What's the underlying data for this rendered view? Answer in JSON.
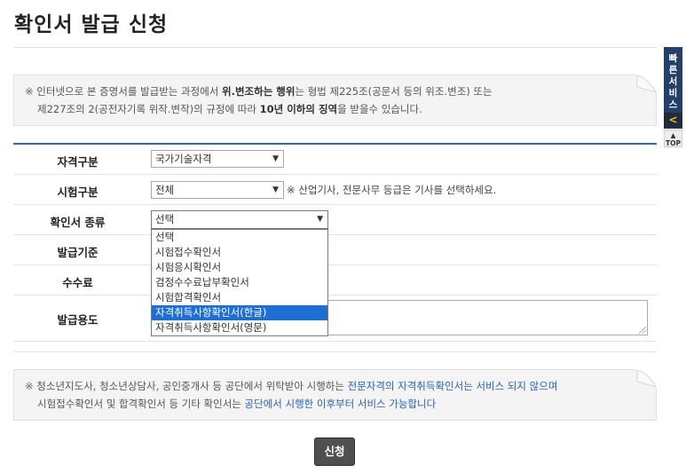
{
  "page_title": "확인서 발급 신청",
  "notice_top": {
    "mark": "※",
    "line1_a": "인터넷으로 본 증명서를 발급받는 과정에서 ",
    "line1_b": "위.변조하는 행위",
    "line1_c": "는 형법 제225조(공문서 등의 위조.변조) 또는",
    "line2_a": "제227조의 2(공전자기록 위작.변작)의 규정에 따라 ",
    "line2_b": "10년 이하의 징역",
    "line2_c": "을 받을수 있습니다."
  },
  "form": {
    "qual_type": {
      "label": "자격구분",
      "value": "국가기술자격"
    },
    "exam_type": {
      "label": "시험구분",
      "value": "전체",
      "hint": "※ 산업기사, 전문사무 등급은 기사를 선택하세요."
    },
    "cert_type": {
      "label": "확인서 종류",
      "value": "선택",
      "options": [
        "선택",
        "시험접수확인서",
        "시험응시확인서",
        "검정수수료납부확인서",
        "시험합격확인서",
        "자격취득사항확인서(한글)",
        "자격취득사항확인서(영문)"
      ],
      "highlighted": "자격취득사항확인서(한글)"
    },
    "issue_basis": {
      "label": "발급기준"
    },
    "fee": {
      "label": "수수료"
    },
    "purpose": {
      "label": "발급용도"
    }
  },
  "notice_bottom": {
    "mark": "※",
    "line1_a": "청소년지도사, 청소년상담사, 공인중개사 등 공단에서 위탁받아 시행하는 ",
    "line1_b": "전문자격의 자격취득확인서는 서비스 되지 않으며",
    "line2_a": "시험접수확인서 및 합격확인서 등 기타 확인서는 ",
    "line2_b": "공단에서 시행한 이후부터 서비스 가능합니다"
  },
  "submit_label": "신청",
  "quick_service": {
    "label_chars": [
      "빠",
      "른",
      "서",
      "비",
      "스"
    ],
    "toggle": "<",
    "top_label": "TOP"
  }
}
